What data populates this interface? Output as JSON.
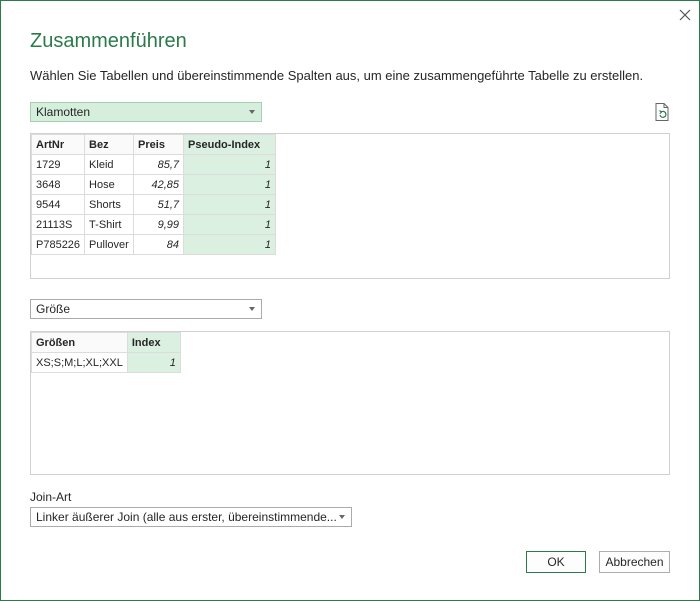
{
  "dialog": {
    "title": "Zusammenführen",
    "subtitle": "Wählen Sie Tabellen und übereinstimmende Spalten aus, um eine zusammengeführte Tabelle zu erstellen."
  },
  "table1": {
    "selected": "Klamotten",
    "columns": [
      "ArtNr",
      "Bez",
      "Preis",
      "Pseudo-Index"
    ],
    "rows": [
      [
        "1729",
        "Kleid",
        "85,7",
        "1"
      ],
      [
        "3648",
        "Hose",
        "42,85",
        "1"
      ],
      [
        "9544",
        "Shorts",
        "51,7",
        "1"
      ],
      [
        "21113S",
        "T-Shirt",
        "9,99",
        "1"
      ],
      [
        "P785226",
        "Pullover",
        "84",
        "1"
      ]
    ]
  },
  "table2": {
    "selected": "Größe",
    "columns": [
      "Größen",
      "Index"
    ],
    "rows": [
      [
        "XS;S;M;L;XL;XXL",
        "1"
      ]
    ]
  },
  "join": {
    "label": "Join-Art",
    "selected": "Linker äußerer Join (alle aus erster, übereinstimmende..."
  },
  "buttons": {
    "ok": "OK",
    "cancel": "Abbrechen"
  },
  "icons": {
    "close": "close-icon",
    "refresh": "refresh-document-icon",
    "dropdown": "chevron-down-icon"
  },
  "colors": {
    "accent": "#2b7a4b",
    "selected_column": "#dbf0e1",
    "selected_dropdown": "#d6efdd"
  }
}
